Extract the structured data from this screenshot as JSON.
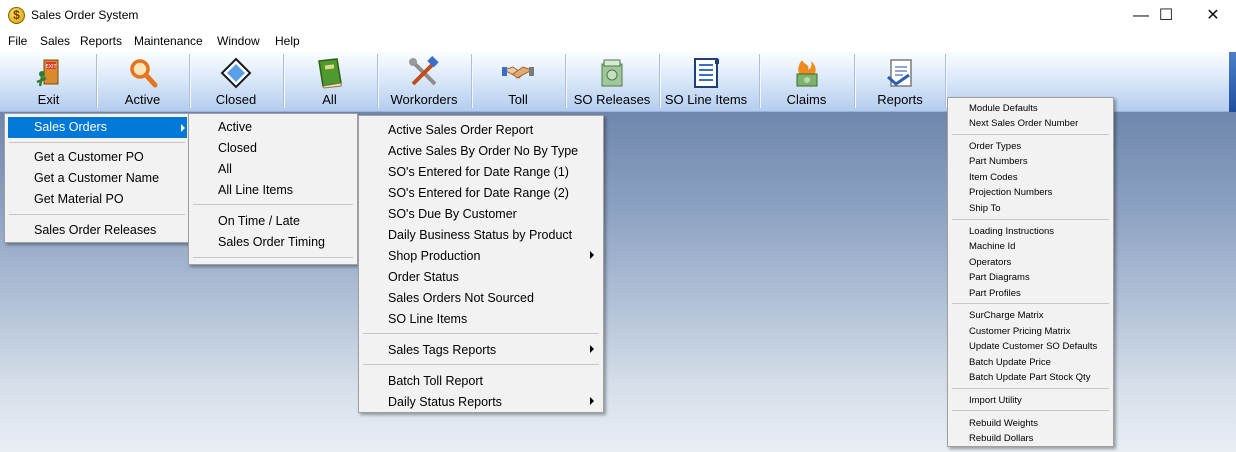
{
  "window": {
    "title": "Sales Order System",
    "icon": "dollar-coin-icon",
    "minimize": "—",
    "maximize": "☐",
    "close": "✕"
  },
  "menubar": [
    "File",
    "Sales",
    "Reports",
    "Maintenance",
    "Window",
    "Help"
  ],
  "toolbar": [
    {
      "label": "Exit",
      "icon": "exit-door-icon"
    },
    {
      "label": "Active",
      "icon": "magnifier-icon"
    },
    {
      "label": "Closed",
      "icon": "diamond-icon"
    },
    {
      "label": "All",
      "icon": "green-book-icon"
    },
    {
      "label": "Workorders",
      "icon": "tools-icon"
    },
    {
      "label": "Toll",
      "icon": "handshake-icon"
    },
    {
      "label": "SO Releases",
      "icon": "money-stack-icon"
    },
    {
      "label": "SO Line Items",
      "icon": "document-list-icon"
    },
    {
      "label": "Claims",
      "icon": "money-fire-icon"
    },
    {
      "label": "Reports",
      "icon": "report-icon"
    }
  ],
  "sales_menu": {
    "items": [
      "Sales Orders",
      "Get a Customer PO",
      "Get a Customer Name",
      "Get Material PO",
      "Sales Order Releases"
    ]
  },
  "sales_orders_menu": {
    "items": [
      "Active",
      "Closed",
      "All",
      "All Line Items",
      "On Time / Late",
      "Sales Order Timing"
    ]
  },
  "reports_menu": {
    "items": [
      "Active Sales Order Report",
      "Active Sales By Order No By Type",
      "SO's Entered for Date Range (1)",
      "SO's Entered for Date Range (2)",
      "SO's Due By Customer",
      "Daily Business Status by Product",
      "Shop Production",
      "Order Status",
      "Sales Orders Not Sourced",
      "SO Line Items",
      "Sales Tags Reports",
      "Batch Toll Report",
      "Daily Status Reports"
    ]
  },
  "maintenance_menu": {
    "items": [
      "Module Defaults",
      "Next Sales Order Number",
      "Order Types",
      "Part Numbers",
      "Item Codes",
      "Projection Numbers",
      "Ship To",
      "Loading Instructions",
      "Machine Id",
      "Operators",
      "Part Diagrams",
      "Part Profiles",
      "SurCharge Matrix",
      "Customer Pricing Matrix",
      "Update Customer SO Defaults",
      "Batch Update Price",
      "Batch Update Part Stock Qty",
      "Import Utility",
      "Rebuild Weights",
      "Rebuild Dollars"
    ]
  },
  "colors": {
    "highlight": "#0078d7",
    "toolbar_edge": "#2a5aa8"
  }
}
